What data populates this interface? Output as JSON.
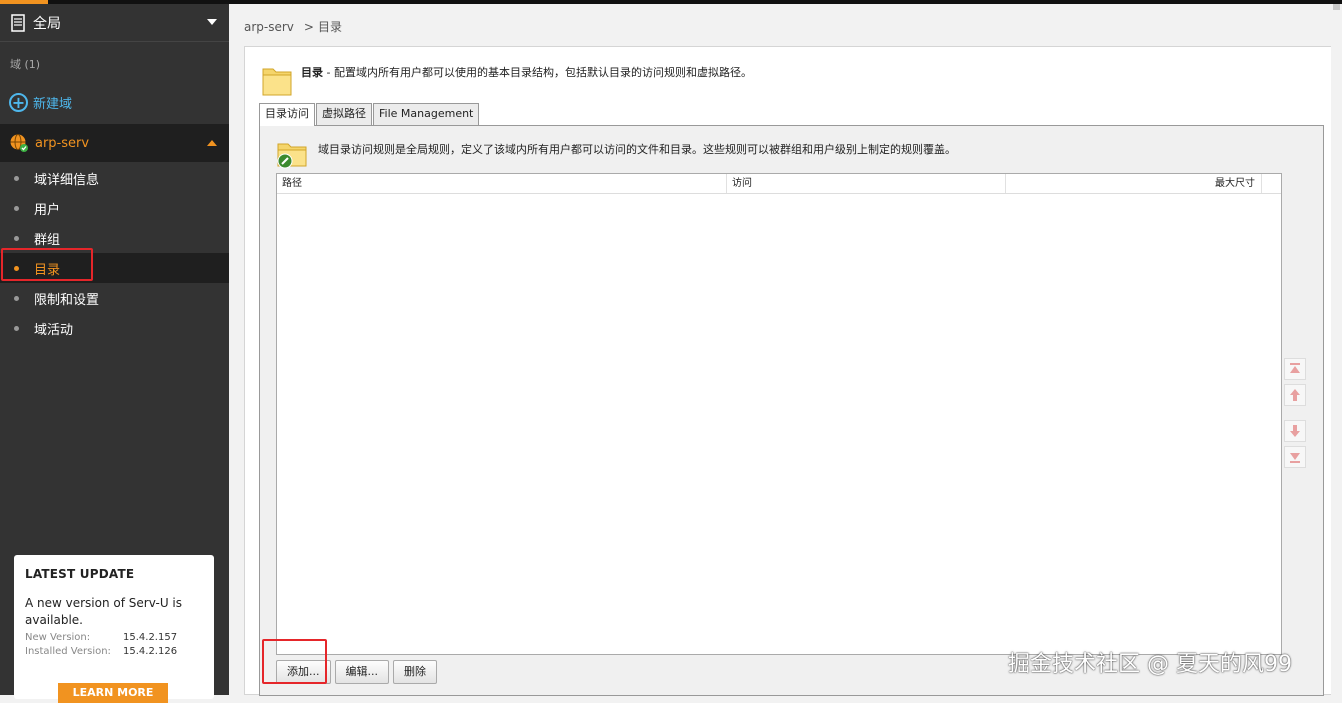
{
  "sidebar": {
    "global_label": "全局",
    "domain_count": "域 (1)",
    "new_domain": "新建域",
    "domain_name": "arp-serv",
    "items": [
      {
        "label": "域详细信息"
      },
      {
        "label": "用户"
      },
      {
        "label": "群组"
      },
      {
        "label": "目录"
      },
      {
        "label": "限制和设置"
      },
      {
        "label": "域活动"
      }
    ],
    "active_index": 3
  },
  "update": {
    "heading": "LATEST UPDATE",
    "message": "A new version of Serv-U is available.",
    "new_version_label": "New Version:",
    "new_version": "15.4.2.157",
    "installed_label": "Installed Version:",
    "installed_version": "15.4.2.126",
    "learn_more": "LEARN MORE"
  },
  "breadcrumb": {
    "root": "arp-serv",
    "sep": ">",
    "current": "目录"
  },
  "panel": {
    "title": "目录",
    "description": " - 配置域内所有用户都可以使用的基本目录结构，包括默认目录的访问规则和虚拟路径。",
    "tabs": [
      "目录访问",
      "虚拟路径",
      "File Management"
    ],
    "tab_desc": "域目录访问规则是全局规则，定义了该域内所有用户都可以访问的文件和目录。这些规则可以被群组和用户级别上制定的规则覆盖。",
    "columns": [
      "路径",
      "访问",
      "最大尺寸"
    ],
    "buttons": {
      "add": "添加...",
      "edit": "编辑...",
      "delete": "删除"
    }
  },
  "watermark": "掘金技术社区 @ 夏天的风99",
  "colors": {
    "accent": "#f19320",
    "link": "#4eb7ec",
    "highlight": "#e5262a"
  }
}
